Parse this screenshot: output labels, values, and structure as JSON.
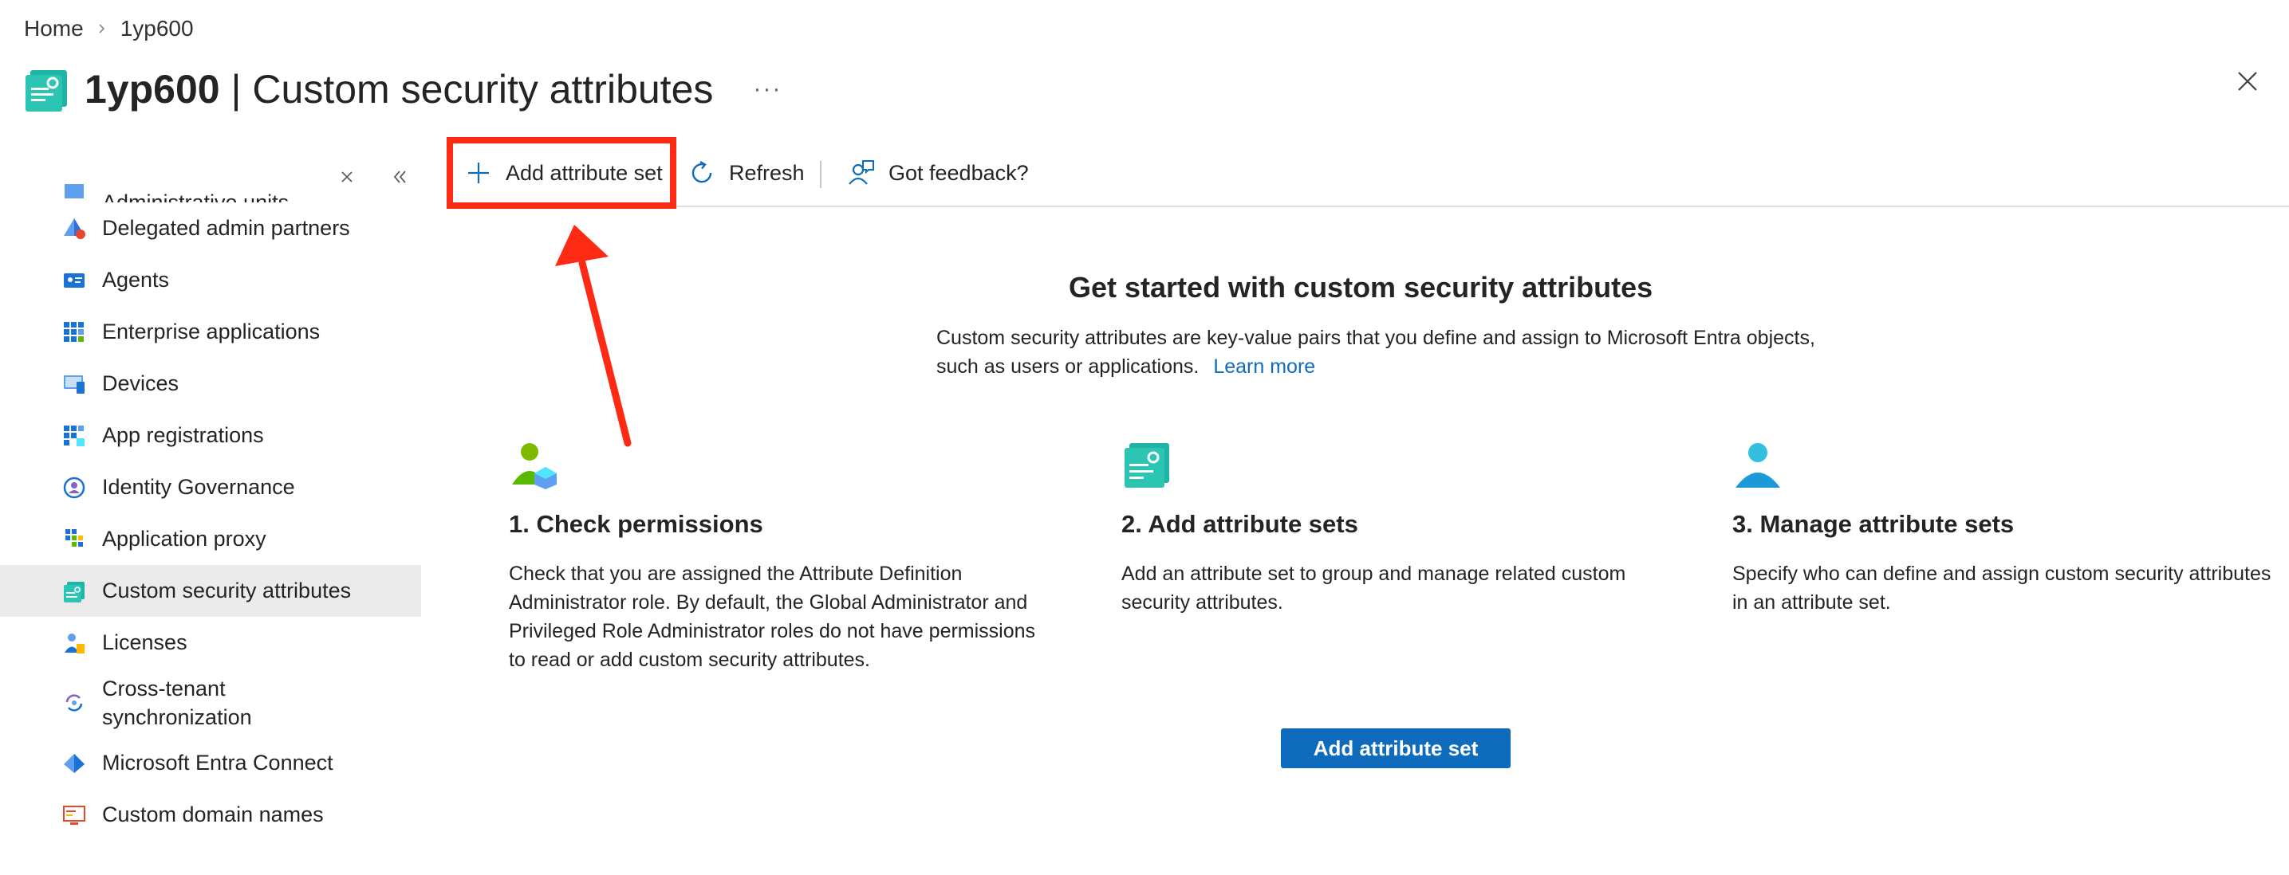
{
  "breadcrumb": {
    "home": "Home",
    "current": "1yp600"
  },
  "header": {
    "tenant": "1yp600",
    "separator": "|",
    "title": "Custom security attributes",
    "more": "···"
  },
  "sidebar": {
    "items": [
      {
        "label": "Administrative units",
        "icon": "admin-units-icon"
      },
      {
        "label": "Delegated admin partners",
        "icon": "delegated-admin-icon"
      },
      {
        "label": "Agents",
        "icon": "agents-icon"
      },
      {
        "label": "Enterprise applications",
        "icon": "enterprise-apps-icon"
      },
      {
        "label": "Devices",
        "icon": "devices-icon"
      },
      {
        "label": "App registrations",
        "icon": "app-registrations-icon"
      },
      {
        "label": "Identity Governance",
        "icon": "identity-governance-icon"
      },
      {
        "label": "Application proxy",
        "icon": "application-proxy-icon"
      },
      {
        "label": "Custom security attributes",
        "icon": "custom-attributes-icon"
      },
      {
        "label": "Licenses",
        "icon": "licenses-icon"
      },
      {
        "label": "Cross-tenant synchronization",
        "icon": "cross-tenant-sync-icon"
      },
      {
        "label": "Microsoft Entra Connect",
        "icon": "entra-connect-icon"
      },
      {
        "label": "Custom domain names",
        "icon": "custom-domain-icon"
      }
    ]
  },
  "toolbar": {
    "add_label": "Add attribute set",
    "refresh_label": "Refresh",
    "feedback_label": "Got feedback?"
  },
  "main": {
    "title": "Get started with custom security attributes",
    "description": "Custom security attributes are key-value pairs that you define and assign to Microsoft Entra objects, such as users or applications.",
    "learn_more": "Learn more",
    "steps": [
      {
        "title": "1. Check permissions",
        "text": "Check that you are assigned the Attribute Definition Administrator role. By default, the Global Administrator and Privileged Role Administrator roles do not have permissions to read or add custom security attributes."
      },
      {
        "title": "2. Add attribute sets",
        "text": "Add an attribute set to group and manage related custom security attributes."
      },
      {
        "title": "3. Manage attribute sets",
        "text": "Specify who can define and assign custom security attributes in an attribute set."
      }
    ],
    "button_label": "Add attribute set"
  },
  "colors": {
    "accent": "#0f6cbd",
    "highlight": "#ff2a14",
    "active_bg": "#ebebeb"
  }
}
